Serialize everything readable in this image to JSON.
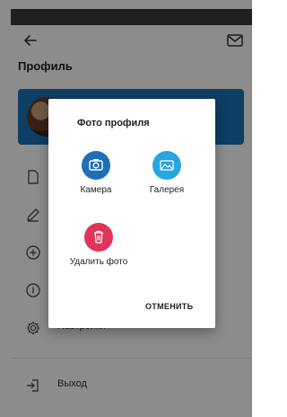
{
  "header": {
    "title": "Профиль"
  },
  "icons": {
    "back": "arrow-left-icon",
    "mail": "mail-icon",
    "camera": "camera-icon",
    "gallery": "image-icon",
    "delete": "trash-icon"
  },
  "menu": {
    "items": [
      {
        "label": "",
        "icon": "document-icon"
      },
      {
        "label": "",
        "icon": "pencil-icon"
      },
      {
        "label": "",
        "icon": "plus-circle-icon"
      },
      {
        "label": "",
        "icon": "info-icon"
      },
      {
        "label": "Настройки",
        "icon": "gear-icon"
      }
    ],
    "logout": {
      "label": "Выход",
      "icon": "logout-icon"
    }
  },
  "dialog": {
    "title": "Фото профиля",
    "options": [
      {
        "label": "Камера",
        "color": "#1f6fb8"
      },
      {
        "label": "Галерея",
        "color": "#27a6e0"
      },
      {
        "label": "Удалить фото",
        "color": "#e0355a"
      }
    ],
    "cancel_label": "ОТМЕНИТЬ"
  },
  "colors": {
    "accent": "#1a73b6",
    "statusbar": "#3b3b3b"
  }
}
